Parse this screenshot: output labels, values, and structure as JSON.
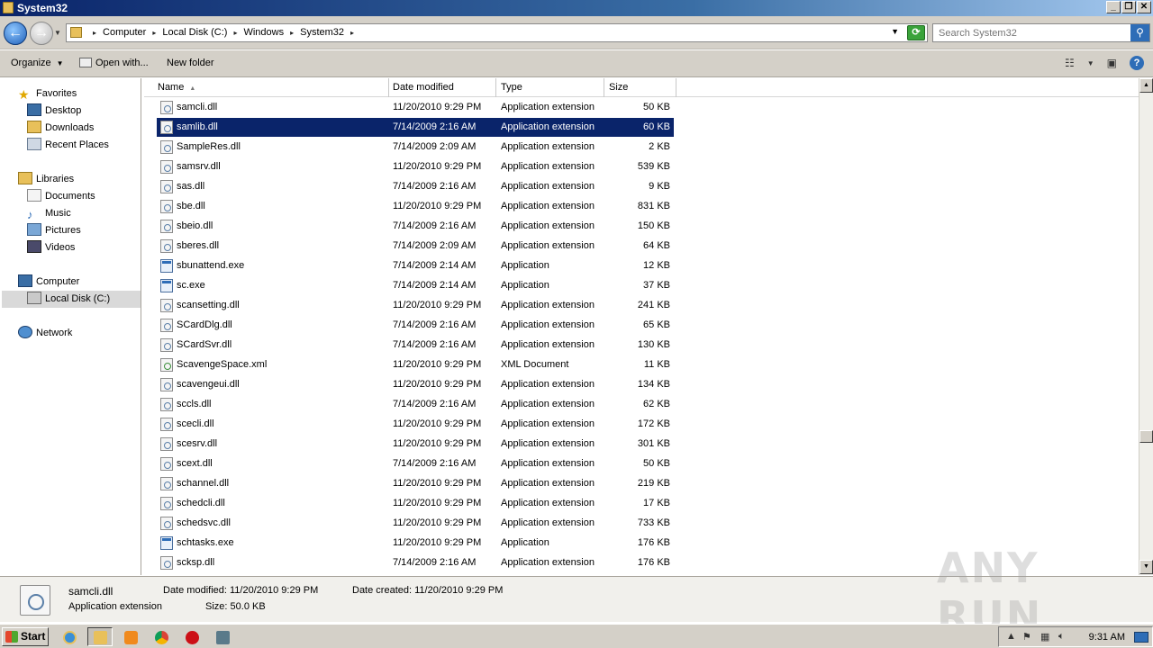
{
  "window": {
    "title": "System32"
  },
  "address": {
    "crumbs": [
      "Computer",
      "Local Disk (C:)",
      "Windows",
      "System32"
    ]
  },
  "search": {
    "placeholder": "Search System32"
  },
  "commands": {
    "organize": "Organize",
    "open_with": "Open with...",
    "new_folder": "New folder"
  },
  "nav": {
    "favorites": "Favorites",
    "desktop": "Desktop",
    "downloads": "Downloads",
    "recent_places": "Recent Places",
    "libraries": "Libraries",
    "documents": "Documents",
    "music": "Music",
    "pictures": "Pictures",
    "videos": "Videos",
    "computer": "Computer",
    "local_disk": "Local Disk (C:)",
    "network": "Network"
  },
  "columns": {
    "name": "Name",
    "date": "Date modified",
    "type": "Type",
    "size": "Size"
  },
  "files": [
    {
      "name": "samcli.dll",
      "date": "11/20/2010 9:29 PM",
      "type": "Application extension",
      "size": "50 KB",
      "kind": "dll"
    },
    {
      "name": "samlib.dll",
      "date": "7/14/2009 2:16 AM",
      "type": "Application extension",
      "size": "60 KB",
      "kind": "dll"
    },
    {
      "name": "SampleRes.dll",
      "date": "7/14/2009 2:09 AM",
      "type": "Application extension",
      "size": "2 KB",
      "kind": "dll"
    },
    {
      "name": "samsrv.dll",
      "date": "11/20/2010 9:29 PM",
      "type": "Application extension",
      "size": "539 KB",
      "kind": "dll"
    },
    {
      "name": "sas.dll",
      "date": "7/14/2009 2:16 AM",
      "type": "Application extension",
      "size": "9 KB",
      "kind": "dll"
    },
    {
      "name": "sbe.dll",
      "date": "11/20/2010 9:29 PM",
      "type": "Application extension",
      "size": "831 KB",
      "kind": "dll"
    },
    {
      "name": "sbeio.dll",
      "date": "7/14/2009 2:16 AM",
      "type": "Application extension",
      "size": "150 KB",
      "kind": "dll"
    },
    {
      "name": "sberes.dll",
      "date": "7/14/2009 2:09 AM",
      "type": "Application extension",
      "size": "64 KB",
      "kind": "dll"
    },
    {
      "name": "sbunattend.exe",
      "date": "7/14/2009 2:14 AM",
      "type": "Application",
      "size": "12 KB",
      "kind": "exe"
    },
    {
      "name": "sc.exe",
      "date": "7/14/2009 2:14 AM",
      "type": "Application",
      "size": "37 KB",
      "kind": "exe"
    },
    {
      "name": "scansetting.dll",
      "date": "11/20/2010 9:29 PM",
      "type": "Application extension",
      "size": "241 KB",
      "kind": "dll"
    },
    {
      "name": "SCardDlg.dll",
      "date": "7/14/2009 2:16 AM",
      "type": "Application extension",
      "size": "65 KB",
      "kind": "dll"
    },
    {
      "name": "SCardSvr.dll",
      "date": "7/14/2009 2:16 AM",
      "type": "Application extension",
      "size": "130 KB",
      "kind": "dll"
    },
    {
      "name": "ScavengeSpace.xml",
      "date": "11/20/2010 9:29 PM",
      "type": "XML Document",
      "size": "11 KB",
      "kind": "xml"
    },
    {
      "name": "scavengeui.dll",
      "date": "11/20/2010 9:29 PM",
      "type": "Application extension",
      "size": "134 KB",
      "kind": "dll"
    },
    {
      "name": "sccls.dll",
      "date": "7/14/2009 2:16 AM",
      "type": "Application extension",
      "size": "62 KB",
      "kind": "dll"
    },
    {
      "name": "scecli.dll",
      "date": "11/20/2010 9:29 PM",
      "type": "Application extension",
      "size": "172 KB",
      "kind": "dll"
    },
    {
      "name": "scesrv.dll",
      "date": "11/20/2010 9:29 PM",
      "type": "Application extension",
      "size": "301 KB",
      "kind": "dll"
    },
    {
      "name": "scext.dll",
      "date": "7/14/2009 2:16 AM",
      "type": "Application extension",
      "size": "50 KB",
      "kind": "dll"
    },
    {
      "name": "schannel.dll",
      "date": "11/20/2010 9:29 PM",
      "type": "Application extension",
      "size": "219 KB",
      "kind": "dll"
    },
    {
      "name": "schedcli.dll",
      "date": "11/20/2010 9:29 PM",
      "type": "Application extension",
      "size": "17 KB",
      "kind": "dll"
    },
    {
      "name": "schedsvc.dll",
      "date": "11/20/2010 9:29 PM",
      "type": "Application extension",
      "size": "733 KB",
      "kind": "dll"
    },
    {
      "name": "schtasks.exe",
      "date": "11/20/2010 9:29 PM",
      "type": "Application",
      "size": "176 KB",
      "kind": "exe"
    },
    {
      "name": "scksp.dll",
      "date": "7/14/2009 2:16 AM",
      "type": "Application extension",
      "size": "176 KB",
      "kind": "dll"
    }
  ],
  "selected_index": 1,
  "details": {
    "filename": "samcli.dll",
    "filetype": "Application extension",
    "modified_label": "Date modified:",
    "modified_value": "11/20/2010 9:29 PM",
    "created_label": "Date created:",
    "created_value": "11/20/2010 9:29 PM",
    "size_label": "Size:",
    "size_value": "50.0 KB"
  },
  "watermark": "ANY RUN",
  "taskbar": {
    "start": "Start",
    "clock": "9:31 AM"
  },
  "colors": {
    "selection": "#0a246a",
    "accent": "#2e6db7"
  }
}
